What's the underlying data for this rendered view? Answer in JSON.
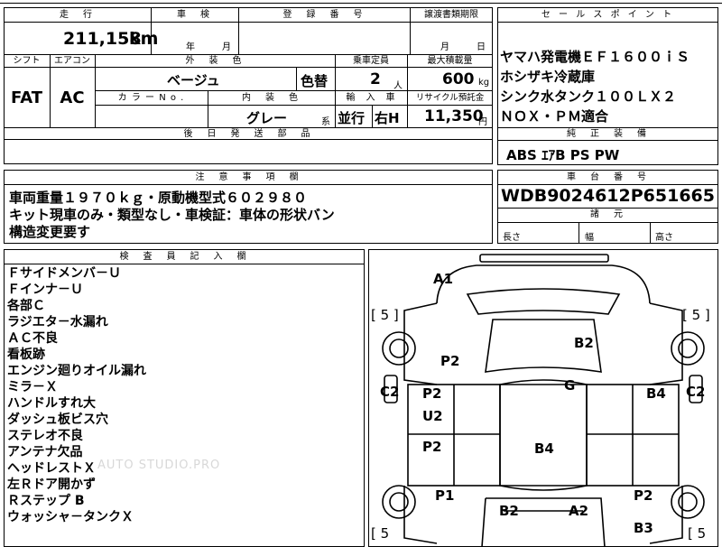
{
  "top_partial": {
    "a": "...",
    "b": "...",
    "c": "..."
  },
  "headers": {
    "mileage": "走　行",
    "inspection": "車　検",
    "registration": "登　録　番　号",
    "transfer_deadline": "譲渡書類期限",
    "shift": "シフト",
    "aircon": "エアコン",
    "exterior_color": "外　装　色",
    "capacity": "乗車定員",
    "max_load": "最大積載量",
    "color_no": "カ ラ ー  N o .",
    "interior_color": "内　装　色",
    "import": "輸　入　車",
    "recycle": "リサイクル預託金",
    "post_delivery": "後　日　発　送　部　品",
    "sales_point": "セ ー ル ス ポ イ ン ト",
    "standard_equipment": "純　正　装　備",
    "notes": "注　意　事　項　欄",
    "chassis_no": "車　台　番　号",
    "dimensions": "諸　元",
    "inspector": "検　査　員　記　入　欄"
  },
  "mileage": {
    "value": "211,158",
    "unit": "km"
  },
  "inspection": {
    "year_label": "年",
    "month_label": "月"
  },
  "transfer_deadline": {
    "month_label": "月",
    "day_label": "日"
  },
  "shift": "FAT",
  "aircon": "AC",
  "exterior_color": "ベージュ",
  "color_change": "色替",
  "capacity": {
    "value": "2",
    "unit": "人"
  },
  "max_load": {
    "value": "600",
    "unit": "kg"
  },
  "interior_color": {
    "value": "グレー",
    "suffix": "系"
  },
  "import_type": {
    "drive": "並行",
    "handle": "右H"
  },
  "recycle": {
    "value": "11,350",
    "unit": "円"
  },
  "sales_points": [
    "ヤマハ発電機ＥＦ１６００ｉＳ",
    "ホシザキ冷蔵庫",
    "シンク水タンク１００ＬＸ２",
    "ＮＯＸ・ＰＭ適合"
  ],
  "standard_equipment": "ABS  ｴｱB  PS  PW",
  "notes": [
    "車両重量１９７０ｋｇ・原動機型式６０２９８０",
    "キット現車のみ・類型なし・車検証：車体の形状バン",
    "構造変更要す"
  ],
  "chassis_number": "WDB9024612P651665",
  "dimensions": {
    "length": "長さ",
    "width": "幅",
    "height": "高さ"
  },
  "inspector_notes": [
    "Ｆサイドメンバ－Ｕ",
    "Ｆインナ－Ｕ",
    "各部Ｃ",
    "ラジエタ－水漏れ",
    "ＡＣ不良",
    "看板跡",
    "エンジン廻りオイル漏れ",
    "ミラ－Ｘ",
    "ハンドルすれ大",
    "ダッシュ板ビス穴",
    "ステレオ不良",
    "アンテナ欠品",
    "ヘッドレストＸ",
    "左Ｒドア開かず",
    "Ｒステップ B",
    "ウォッシャ－タンクＸ"
  ],
  "watermark": "AUTO STUDIO.PRO",
  "damage_marks": {
    "a1": "A1",
    "b2_hood": "B2",
    "p2_front_left": "P2",
    "g": "G",
    "c2_left": "C2",
    "c2_right": "C2",
    "p2_left_door1": "P2",
    "u2": "U2",
    "b4_right": "B4",
    "p2_left_door2": "P2",
    "b4_roof": "B4",
    "p1": "P1",
    "p2_right_rear": "P2",
    "b2_rear": "B2",
    "a2": "A2",
    "b3": "B3",
    "tire_fl": "[ 5 ]",
    "tire_fr": "[ 5 ]",
    "tire_rl": "[ 5",
    "tire_rr": "[ 5"
  }
}
